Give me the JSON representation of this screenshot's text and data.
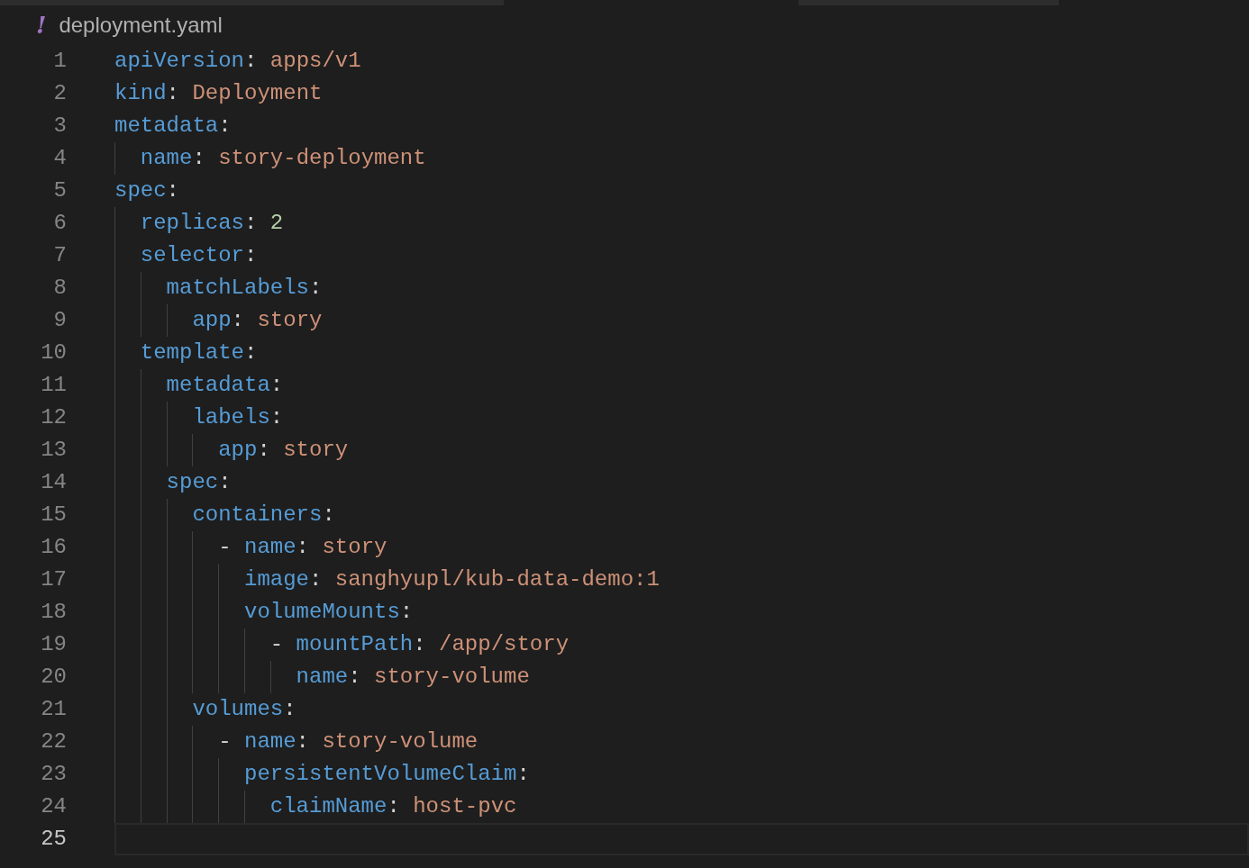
{
  "breadcrumb": {
    "icon": "!",
    "file_name": "deployment.yaml"
  },
  "editor": {
    "lines": [
      {
        "number": "1",
        "current": false,
        "tokens": [
          {
            "kind": "key",
            "text": "apiVersion"
          },
          {
            "kind": "punct",
            "text": ": "
          },
          {
            "kind": "string",
            "text": "apps/v1"
          }
        ]
      },
      {
        "number": "2",
        "current": false,
        "tokens": [
          {
            "kind": "key",
            "text": "kind"
          },
          {
            "kind": "punct",
            "text": ": "
          },
          {
            "kind": "string",
            "text": "Deployment"
          }
        ]
      },
      {
        "number": "3",
        "current": false,
        "tokens": [
          {
            "kind": "key",
            "text": "metadata"
          },
          {
            "kind": "punct",
            "text": ":"
          }
        ],
        "children": [
          {
            "number": "4",
            "current": false,
            "tokens": [
              {
                "kind": "key",
                "text": "name"
              },
              {
                "kind": "punct",
                "text": ": "
              },
              {
                "kind": "string",
                "text": "story-deployment"
              }
            ]
          }
        ]
      },
      {
        "number": "5",
        "current": false,
        "tokens": [
          {
            "kind": "key",
            "text": "spec"
          },
          {
            "kind": "punct",
            "text": ":"
          }
        ],
        "children": [
          {
            "number": "6",
            "current": false,
            "tokens": [
              {
                "kind": "key",
                "text": "replicas"
              },
              {
                "kind": "punct",
                "text": ": "
              },
              {
                "kind": "number",
                "text": "2"
              }
            ]
          },
          {
            "number": "7",
            "current": false,
            "tokens": [
              {
                "kind": "key",
                "text": "selector"
              },
              {
                "kind": "punct",
                "text": ":"
              }
            ],
            "children": [
              {
                "number": "8",
                "current": false,
                "tokens": [
                  {
                    "kind": "key",
                    "text": "matchLabels"
                  },
                  {
                    "kind": "punct",
                    "text": ":"
                  }
                ],
                "children": [
                  {
                    "number": "9",
                    "current": false,
                    "tokens": [
                      {
                        "kind": "key",
                        "text": "app"
                      },
                      {
                        "kind": "punct",
                        "text": ": "
                      },
                      {
                        "kind": "string",
                        "text": "story"
                      }
                    ]
                  }
                ]
              }
            ]
          },
          {
            "number": "10",
            "current": false,
            "tokens": [
              {
                "kind": "key",
                "text": "template"
              },
              {
                "kind": "punct",
                "text": ":"
              }
            ],
            "children": [
              {
                "number": "11",
                "current": false,
                "tokens": [
                  {
                    "kind": "key",
                    "text": "metadata"
                  },
                  {
                    "kind": "punct",
                    "text": ":"
                  }
                ],
                "children": [
                  {
                    "number": "12",
                    "current": false,
                    "tokens": [
                      {
                        "kind": "key",
                        "text": "labels"
                      },
                      {
                        "kind": "punct",
                        "text": ":"
                      }
                    ],
                    "children": [
                      {
                        "number": "13",
                        "current": false,
                        "tokens": [
                          {
                            "kind": "key",
                            "text": "app"
                          },
                          {
                            "kind": "punct",
                            "text": ": "
                          },
                          {
                            "kind": "string",
                            "text": "story"
                          }
                        ]
                      }
                    ]
                  }
                ]
              },
              {
                "number": "14",
                "current": false,
                "tokens": [
                  {
                    "kind": "key",
                    "text": "spec"
                  },
                  {
                    "kind": "punct",
                    "text": ":"
                  }
                ],
                "children": [
                  {
                    "number": "15",
                    "current": false,
                    "tokens": [
                      {
                        "kind": "key",
                        "text": "containers"
                      },
                      {
                        "kind": "punct",
                        "text": ":"
                      }
                    ],
                    "children": [
                      {
                        "number": "16",
                        "current": false,
                        "tokens": [
                          {
                            "kind": "punct",
                            "text": "- "
                          },
                          {
                            "kind": "key",
                            "text": "name"
                          },
                          {
                            "kind": "punct",
                            "text": ": "
                          },
                          {
                            "kind": "string",
                            "text": "story"
                          }
                        ],
                        "children": [
                          {
                            "number": "17",
                            "current": false,
                            "tokens": [
                              {
                                "kind": "key",
                                "text": "image"
                              },
                              {
                                "kind": "punct",
                                "text": ": "
                              },
                              {
                                "kind": "string",
                                "text": "sanghyupl/kub-data-demo:1"
                              }
                            ]
                          },
                          {
                            "number": "18",
                            "current": false,
                            "tokens": [
                              {
                                "kind": "key",
                                "text": "volumeMounts"
                              },
                              {
                                "kind": "punct",
                                "text": ":"
                              }
                            ],
                            "children": [
                              {
                                "number": "19",
                                "current": false,
                                "tokens": [
                                  {
                                    "kind": "punct",
                                    "text": "- "
                                  },
                                  {
                                    "kind": "key",
                                    "text": "mountPath"
                                  },
                                  {
                                    "kind": "punct",
                                    "text": ": "
                                  },
                                  {
                                    "kind": "string",
                                    "text": "/app/story"
                                  }
                                ],
                                "children": [
                                  {
                                    "number": "20",
                                    "current": false,
                                    "tokens": [
                                      {
                                        "kind": "key",
                                        "text": "name"
                                      },
                                      {
                                        "kind": "punct",
                                        "text": ": "
                                      },
                                      {
                                        "kind": "string",
                                        "text": "story-volume"
                                      }
                                    ]
                                  }
                                ]
                              }
                            ]
                          }
                        ]
                      }
                    ]
                  },
                  {
                    "number": "21",
                    "current": false,
                    "tokens": [
                      {
                        "kind": "key",
                        "text": "volumes"
                      },
                      {
                        "kind": "punct",
                        "text": ":"
                      }
                    ],
                    "children": [
                      {
                        "number": "22",
                        "current": false,
                        "tokens": [
                          {
                            "kind": "punct",
                            "text": "- "
                          },
                          {
                            "kind": "key",
                            "text": "name"
                          },
                          {
                            "kind": "punct",
                            "text": ": "
                          },
                          {
                            "kind": "string",
                            "text": "story-volume"
                          }
                        ],
                        "children": [
                          {
                            "number": "23",
                            "current": false,
                            "tokens": [
                              {
                                "kind": "key",
                                "text": "persistentVolumeClaim"
                              },
                              {
                                "kind": "punct",
                                "text": ":"
                              }
                            ],
                            "children": [
                              {
                                "number": "24",
                                "current": false,
                                "tokens": [
                                  {
                                    "kind": "key",
                                    "text": "claimName"
                                  },
                                  {
                                    "kind": "punct",
                                    "text": ": "
                                  },
                                  {
                                    "kind": "string",
                                    "text": "host-pvc"
                                  }
                                ]
                              }
                            ]
                          }
                        ]
                      }
                    ]
                  }
                ]
              }
            ]
          }
        ]
      },
      {
        "number": "25",
        "current": true
      }
    ]
  }
}
